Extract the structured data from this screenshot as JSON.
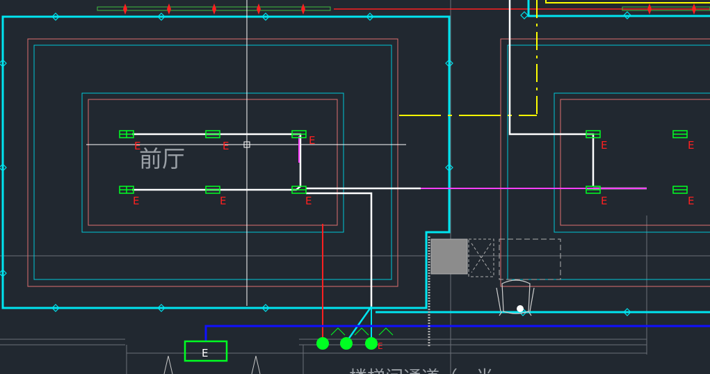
{
  "room": {
    "name": "前厅"
  },
  "bottom_text": "楼梯间通道（一半",
  "fixture_marker": "E",
  "exit_sign_label": "E",
  "colors": {
    "background": "#212830",
    "wall_cyan": "#00e5f0",
    "ceiling_red": "#e07070",
    "circuit_white": "#ffffff",
    "fixture_green": "#00ff22",
    "marker_red": "#ff2020",
    "dashed_yellow": "#ffff00",
    "bus_blue": "#1010ff",
    "magenta": "#ff40ff"
  }
}
